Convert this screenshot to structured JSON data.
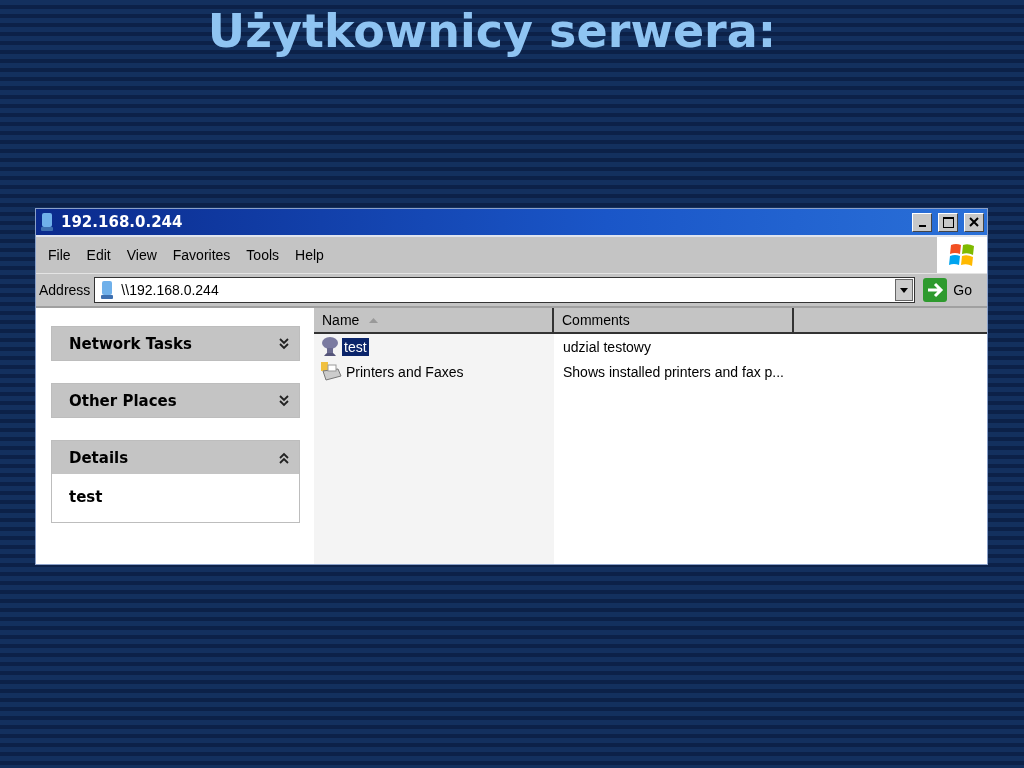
{
  "slide_title": "Użytkownicy serwera:",
  "window": {
    "title": "192.168.0.244"
  },
  "menu": [
    "File",
    "Edit",
    "View",
    "Favorites",
    "Tools",
    "Help"
  ],
  "address_bar": {
    "label": "Address",
    "value": "\\\\192.168.0.244",
    "go": "Go"
  },
  "task_panels": [
    {
      "title": "Network Tasks",
      "expanded": false
    },
    {
      "title": "Other Places",
      "expanded": false
    },
    {
      "title": "Details",
      "expanded": true,
      "body": "test"
    }
  ],
  "table": {
    "columns": [
      "Name",
      "Comments"
    ],
    "rows": [
      {
        "kind": "share",
        "name": "test",
        "comment": "udzial testowy",
        "selected": true
      },
      {
        "kind": "printers",
        "name": "Printers and Faxes",
        "comment": "Shows installed printers and fax p...",
        "selected": false
      }
    ]
  }
}
